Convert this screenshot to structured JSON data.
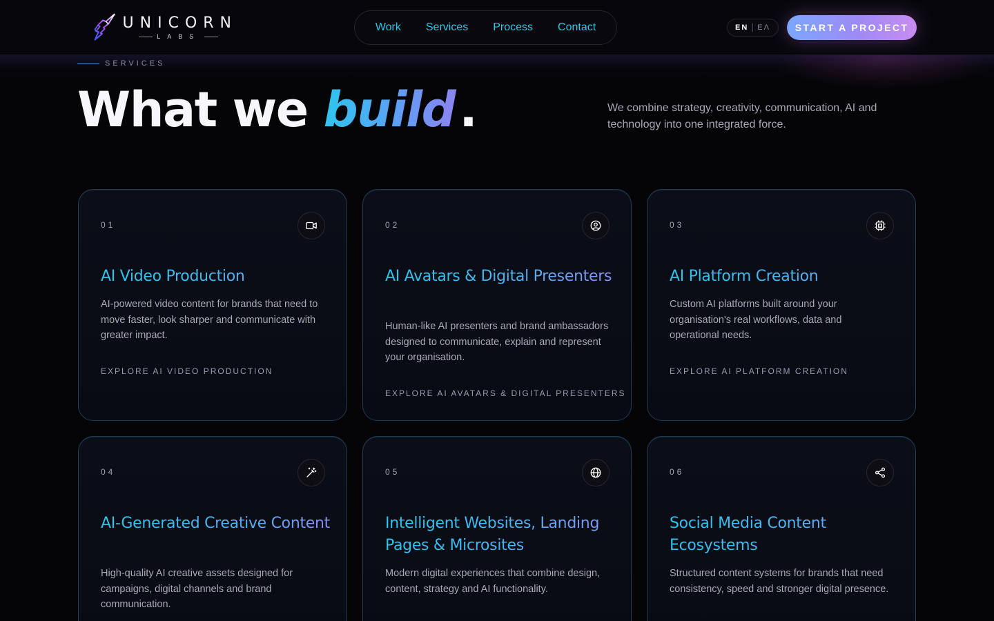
{
  "brand": {
    "name": "UNICORN",
    "sub": "LABS"
  },
  "nav": {
    "items": [
      "Work",
      "Services",
      "Process",
      "Contact"
    ]
  },
  "lang": {
    "active": "EN",
    "other": "EΛ"
  },
  "cta": {
    "label": "START A PROJECT"
  },
  "section": {
    "eyebrow": "SERVICES",
    "headline_pre": "What we ",
    "headline_accent": "build",
    "headline_post": ".",
    "intro": "We combine strategy, creativity, communication, AI and technology into one integrated force."
  },
  "cards": [
    {
      "num": "01",
      "icon": "video-camera-icon",
      "title": "AI Video Production",
      "desc": "AI-powered video content for brands that need to move faster, look sharper and communicate with greater impact.",
      "link": "EXPLORE AI VIDEO PRODUCTION"
    },
    {
      "num": "02",
      "icon": "user-circle-icon",
      "title": "AI Avatars & Digital Presenters",
      "desc": "Human-like AI presenters and brand ambassadors designed to communicate, explain and represent your organisation.",
      "link": "EXPLORE AI AVATARS & DIGITAL PRESENTERS"
    },
    {
      "num": "03",
      "icon": "chip-icon",
      "title": "AI Platform Creation",
      "desc": "Custom AI platforms built around your organisation's real workflows, data and operational needs.",
      "link": "EXPLORE AI PLATFORM CREATION"
    },
    {
      "num": "04",
      "icon": "magic-wand-icon",
      "title": "AI-Generated Creative Content",
      "desc": "High-quality AI creative assets designed for campaigns, digital channels and brand communication.",
      "link": ""
    },
    {
      "num": "05",
      "icon": "globe-icon",
      "title": "Intelligent Websites, Landing Pages & Microsites",
      "desc": "Modern digital experiences that combine design, content, strategy and AI functionality.",
      "link": ""
    },
    {
      "num": "06",
      "icon": "share-icon",
      "title": "Social Media Content Ecosystems",
      "desc": "Structured content systems for brands that need consistency, speed and stronger digital presence.",
      "link": ""
    }
  ]
}
